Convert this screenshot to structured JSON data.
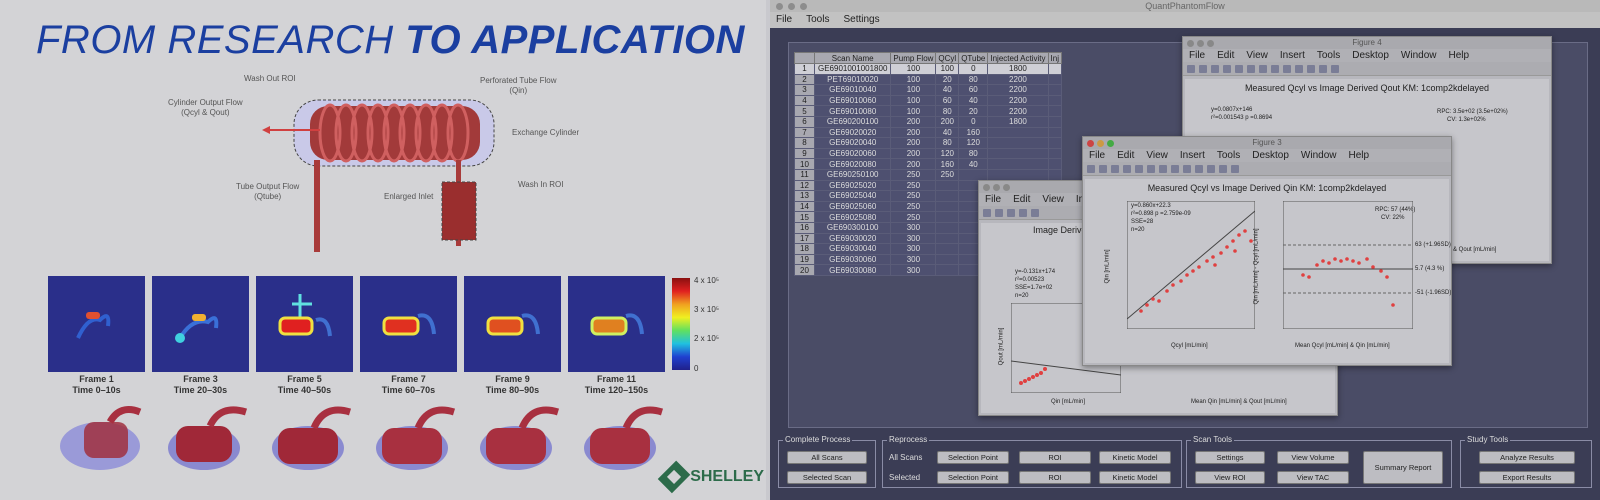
{
  "left": {
    "title_normal": "FROM RESEARCH ",
    "title_bold": "TO APPLICATION",
    "annotations": {
      "wash_out": "Wash Out ROI",
      "perforated": "Perforated Tube Flow\n(Qin)",
      "cylinder_output": "Cylinder Output Flow\n(Qcyl & Qout)",
      "exchange": "Exchange Cylinder",
      "tube_output": "Tube Output Flow\n(Qtube)",
      "enlarged": "Enlarged Inlet",
      "wash_in": "Wash In ROI"
    },
    "frames": [
      {
        "name": "Frame 1",
        "time": "Time 0–10s"
      },
      {
        "name": "Frame 3",
        "time": "Time 20–30s"
      },
      {
        "name": "Frame 5",
        "time": "Time 40–50s"
      },
      {
        "name": "Frame 7",
        "time": "Time 60–70s"
      },
      {
        "name": "Frame 9",
        "time": "Time 80–90s"
      },
      {
        "name": "Frame 11",
        "time": "Time 120–150s"
      }
    ],
    "colorbar_ticks": [
      "4 x 10⁵",
      "3 x 10⁵",
      "2 x 10⁵",
      "0"
    ],
    "logo_text": "SHELLEY"
  },
  "app": {
    "window_title": "QuantPhantomFlow",
    "menu": [
      "File",
      "Tools",
      "Settings"
    ],
    "table": {
      "headers": [
        "",
        "Scan Name",
        "Pump Flow",
        "QCyl",
        "QTube",
        "Injected Activity",
        "Inj"
      ],
      "rows": [
        [
          "1",
          "GE6901001001800",
          "100",
          "100",
          "0",
          "1800"
        ],
        [
          "2",
          "PET69010020",
          "100",
          "20",
          "80",
          "2200"
        ],
        [
          "3",
          "GE69010040",
          "100",
          "40",
          "60",
          "2200"
        ],
        [
          "4",
          "GE69010060",
          "100",
          "60",
          "40",
          "2200"
        ],
        [
          "5",
          "GE69010080",
          "100",
          "80",
          "20",
          "2200"
        ],
        [
          "6",
          "GE690200100",
          "200",
          "200",
          "0",
          "1800"
        ],
        [
          "7",
          "GE69020020",
          "200",
          "40",
          "160",
          ""
        ],
        [
          "8",
          "GE69020040",
          "200",
          "80",
          "120",
          ""
        ],
        [
          "9",
          "GE69020060",
          "200",
          "120",
          "80",
          ""
        ],
        [
          "10",
          "GE69020080",
          "200",
          "160",
          "40",
          ""
        ],
        [
          "11",
          "GE690250100",
          "250",
          "250",
          "",
          ""
        ],
        [
          "12",
          "GE69025020",
          "250",
          "",
          "",
          ""
        ],
        [
          "13",
          "GE69025040",
          "250",
          "",
          "",
          ""
        ],
        [
          "14",
          "GE69025060",
          "250",
          "",
          "",
          ""
        ],
        [
          "15",
          "GE69025080",
          "250",
          "",
          "",
          ""
        ],
        [
          "16",
          "GE690300100",
          "300",
          "",
          "",
          ""
        ],
        [
          "17",
          "GE69030020",
          "300",
          "",
          "",
          ""
        ],
        [
          "18",
          "GE69030040",
          "300",
          "",
          "",
          ""
        ],
        [
          "19",
          "GE69030060",
          "300",
          "",
          "",
          ""
        ],
        [
          "20",
          "GE69030080",
          "300",
          "",
          "",
          ""
        ]
      ]
    },
    "fig4": {
      "title": "Figure 4",
      "menu": [
        "File",
        "Edit",
        "View",
        "Insert",
        "Tools",
        "Desktop",
        "Window",
        "Help"
      ],
      "plot_title": "Measured Qcyl vs Image Derived Qout KM: 1comp2kdelayed",
      "fit_text": "y=0.0807x+146",
      "r2_text": "r²=0.001543   p =0.8694",
      "rpc_text": "RPC: 3.5e+02 (3.5e+02%)",
      "cv_text": "CV: 1.3e+02%",
      "axis_label": "& Qout [mL/min]"
    },
    "fig3": {
      "title": "Figure 3",
      "menu": [
        "File",
        "Edit",
        "View",
        "Insert",
        "Tools",
        "Desktop",
        "Window",
        "Help"
      ],
      "plot_title": "Measured Qcyl vs Image Derived Qin KM: 1comp2kdelayed",
      "fit_text": "y=0.860x+22.3",
      "r2_text": "r²=0.898    p =2.759e-09",
      "sse_text": "SSE=28",
      "n_text": "n=20",
      "rpc_text": "RPC: 57 (44%)",
      "cv_text": "CV: 22%",
      "left_xlabel": "Qcyl [mL/min]",
      "left_ylabel": "Qin [mL/min]",
      "right_xlabel": "Mean Qcyl [mL/min] & Qin [mL/min]",
      "right_ylabel": "Qin [mL/min] - Qcyl [mL/min]",
      "right_lines": [
        "63 (+1.96SD)",
        "5.7 (4.3 %)",
        "-51 (-1.96SD)"
      ]
    },
    "fig2": {
      "menu": [
        "File",
        "Edit",
        "View",
        "Ins"
      ],
      "plot_title": "Image Derive",
      "fit_text": "y=-0.131x+174",
      "r2_text": "r²=0.00523",
      "sse_text": "SSE=1.7e+02",
      "n_text": "n=20",
      "xlabel": "Qin [mL/min]",
      "ylabel": "Qout [mL/min]",
      "xlabel2": "Mean Qin [mL/min] & Qout [mL/min]"
    },
    "panels": {
      "complete": "Complete Process",
      "all_scans": "All Scans",
      "selected_scan": "Selected Scan",
      "reprocess": "Reprocess",
      "all_scans_label": "All Scans",
      "selected_label": "Selected",
      "selection_point": "Selection Point",
      "roi": "ROI",
      "kinetic_model": "Kinetic Model",
      "scan_tools": "Scan Tools",
      "settings": "Settings",
      "view_volume": "View Volume",
      "view_roi": "View ROI",
      "view_tac": "View TAC",
      "summary_report": "Summary Report",
      "study_tools": "Study Tools",
      "analyze_results": "Analyze Results",
      "export_results": "Export Results"
    }
  }
}
